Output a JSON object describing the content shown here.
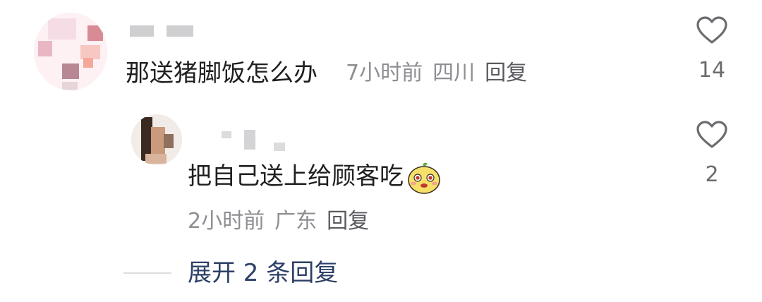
{
  "comments": [
    {
      "text": "那送猪脚饭怎么办",
      "time": "7小时前",
      "location": "四川",
      "reply_label": "回复",
      "likes": "14",
      "avatar_icon": "blurred-avatar-icon"
    },
    {
      "text": "把自己送上给顾客吃",
      "emoji": "cute-face-emoji-icon",
      "time": "2小时前",
      "location": "广东",
      "reply_label": "回复",
      "likes": "2",
      "avatar_icon": "blurred-avatar-icon"
    }
  ],
  "expand_replies_label": "展开 2 条回复",
  "colors": {
    "text": "#1f1f1f",
    "meta": "#8e8e93",
    "link": "#2c3f66",
    "like_icon": "#6b6b70"
  }
}
